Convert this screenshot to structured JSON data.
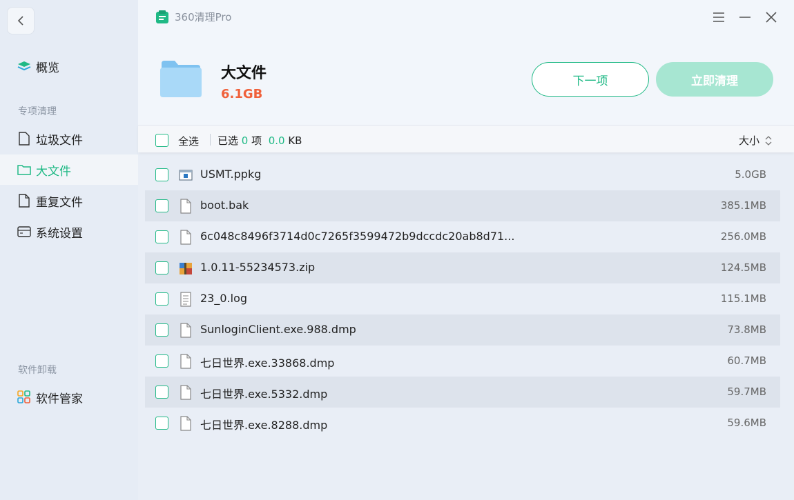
{
  "app": {
    "title": "360清理Pro"
  },
  "sidebar": {
    "overview": "概览",
    "section_special": "专项清理",
    "items": [
      {
        "label": "垃圾文件"
      },
      {
        "label": "大文件"
      },
      {
        "label": "重复文件"
      },
      {
        "label": "系统设置"
      }
    ],
    "section_uninstall": "软件卸载",
    "software_manager": "软件管家"
  },
  "header": {
    "category_title": "大文件",
    "category_size": "6.1GB",
    "next_label": "下一项",
    "clean_label": "立即清理"
  },
  "toolbar": {
    "select_all": "全选",
    "selected_prefix": "已选",
    "selected_count": "0",
    "selected_unit": "项",
    "selected_size": "0.0",
    "size_unit": "KB",
    "sort_label": "大小"
  },
  "files": [
    {
      "name": "USMT.ppkg",
      "size": "5.0GB",
      "icon": "package-icon"
    },
    {
      "name": "boot.bak",
      "size": "385.1MB",
      "icon": "file-icon"
    },
    {
      "name": "6c048c8496f3714d0c7265f3599472b9dccdc20ab8d71...",
      "size": "256.0MB",
      "icon": "file-icon"
    },
    {
      "name": "1.0.11-55234573.zip",
      "size": "124.5MB",
      "icon": "zip-icon"
    },
    {
      "name": "23_0.log",
      "size": "115.1MB",
      "icon": "text-file-icon"
    },
    {
      "name": "SunloginClient.exe.988.dmp",
      "size": "73.8MB",
      "icon": "file-icon"
    },
    {
      "name": "七日世界.exe.33868.dmp",
      "size": "60.7MB",
      "icon": "file-icon"
    },
    {
      "name": "七日世界.exe.5332.dmp",
      "size": "59.7MB",
      "icon": "file-icon"
    },
    {
      "name": "七日世界.exe.8288.dmp",
      "size": "59.6MB",
      "icon": "file-icon"
    }
  ],
  "colors": {
    "accent": "#1fb985",
    "size_highlight": "#f0603a",
    "clean_disabled": "#a7e6d2"
  }
}
